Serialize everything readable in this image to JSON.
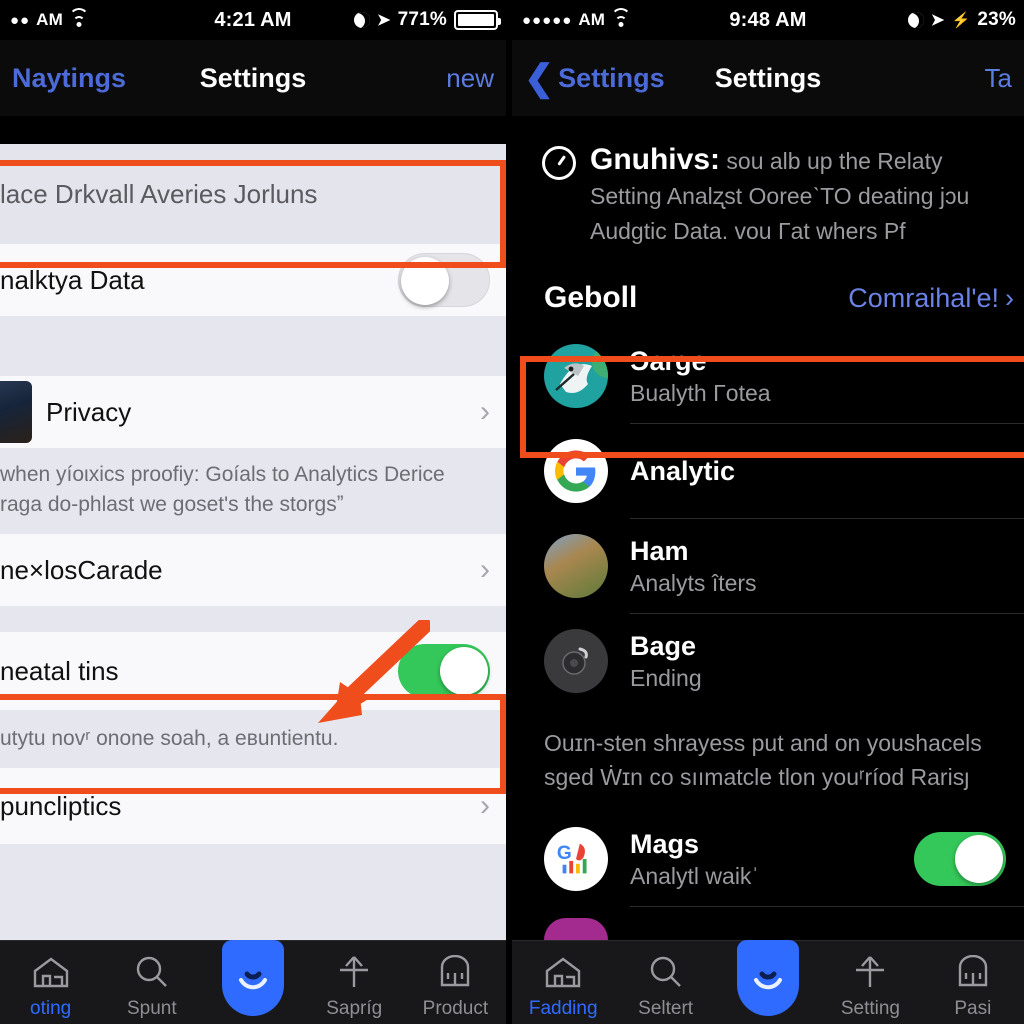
{
  "left_phone": {
    "status_bar": {
      "dots": "●●",
      "carrier": "AM",
      "wifi_icon": "wifi-icon",
      "time": "4:21 AM",
      "moon_icon": "moon-icon",
      "location_icon": "location-arrow-icon",
      "battery_percent": "771%",
      "battery_icon": "battery-icon"
    },
    "nav": {
      "back_label": "Naytings",
      "title": "Settings",
      "right_label": "new"
    },
    "search": {
      "value": "lace Drkvall Averies Jorluns",
      "placeholder": "lace Drkvall Averies Jorluns"
    },
    "rows": [
      {
        "label": "nalktya Data",
        "type": "toggle",
        "toggle": "off"
      },
      {
        "label": "Privacy",
        "type": "chevron",
        "avatar": "person-avatar"
      },
      {
        "label": "ne×losCarade",
        "type": "chevron"
      },
      {
        "label": "neatal tins",
        "type": "toggle",
        "toggle": "on"
      },
      {
        "label": "puncliptics",
        "type": "chevron"
      }
    ],
    "footnotes": {
      "privacy": "when yíoιxics proofiy: Goíals to Analytics Derice raga do-рһlast we ɡoset's the storgsˮ",
      "toggle": "utytu novʳ onone soah, a eʙuntientu."
    },
    "tabs": [
      {
        "label": "oting",
        "icon": "home-icon",
        "active": true
      },
      {
        "label": "Spunt",
        "icon": "search-icon",
        "active": false
      },
      {
        "label": "",
        "icon": "power-pill-icon",
        "active": false
      },
      {
        "label": "Sapríg",
        "icon": "upload-icon",
        "active": false
      },
      {
        "label": "Product",
        "icon": "bag-icon",
        "active": false
      }
    ]
  },
  "right_phone": {
    "status_bar": {
      "dots": "●●●●●",
      "carrier": "AM",
      "wifi_icon": "wifi-icon",
      "time": "9:48 AM",
      "moon_icon": "moon-icon",
      "location_icon": "location-arrow-icon",
      "bolt_icon": "bolt-icon",
      "battery_percent": "23%"
    },
    "nav": {
      "back_chevron": "chevron-left-icon",
      "back_label": "Settings",
      "title": "Settings",
      "right_label": "Ta"
    },
    "info": {
      "icon": "clock-icon",
      "heading": "Gnuhivs:",
      "body": "sou alb up the Relaty Setting Analʐst OoreeˋTO deating jɔu Audɡtic Data. vou Γat whers Pf"
    },
    "section": {
      "title": "Geboll",
      "link": "Comraihalʹe!",
      "link_chevron": "chevron-right-icon"
    },
    "rows": [
      {
        "title": "Ɔarge",
        "sub": "Bualyth Γotea",
        "avatar": "dove-avatar",
        "highlighted": true
      },
      {
        "title": "Analytic",
        "sub": "",
        "avatar": "google-g-avatar"
      },
      {
        "title": "Ham",
        "sub": "Analyts îters",
        "avatar": "person-photo-avatar"
      },
      {
        "title": "Bage",
        "sub": "Ending",
        "avatar": "nest-cam-avatar"
      }
    ],
    "note": "Ouɪn-sten shrayess put and on youshacels sged Ẇɪn co sıımatcle tlon youʳríod Rarisȷ",
    "row_toggle": {
      "title": "Mags",
      "sub": "Analytl waikˈ",
      "avatar": "google-analytics-avatar",
      "toggle": "on"
    },
    "tabs": [
      {
        "label": "Fadding",
        "icon": "home-icon",
        "active": true
      },
      {
        "label": "Seltert",
        "icon": "search-icon",
        "active": false
      },
      {
        "label": "",
        "icon": "power-pill-icon",
        "active": false
      },
      {
        "label": "Setting",
        "icon": "upload-icon",
        "active": false
      },
      {
        "label": "Pasi",
        "icon": "bag-icon",
        "active": false
      }
    ]
  },
  "annotations": {
    "highlight_color": "#ef4d1c",
    "arrow": "pointer-arrow",
    "boxes": [
      "search-field-highlight",
      "toggle-row-highlight",
      "contact-row-highlight"
    ]
  },
  "colors": {
    "accent_blue": "#2f6bff",
    "toggle_green": "#34c759",
    "annotation_orange": "#ef4d1c",
    "link_blue": "#6b83e8"
  }
}
